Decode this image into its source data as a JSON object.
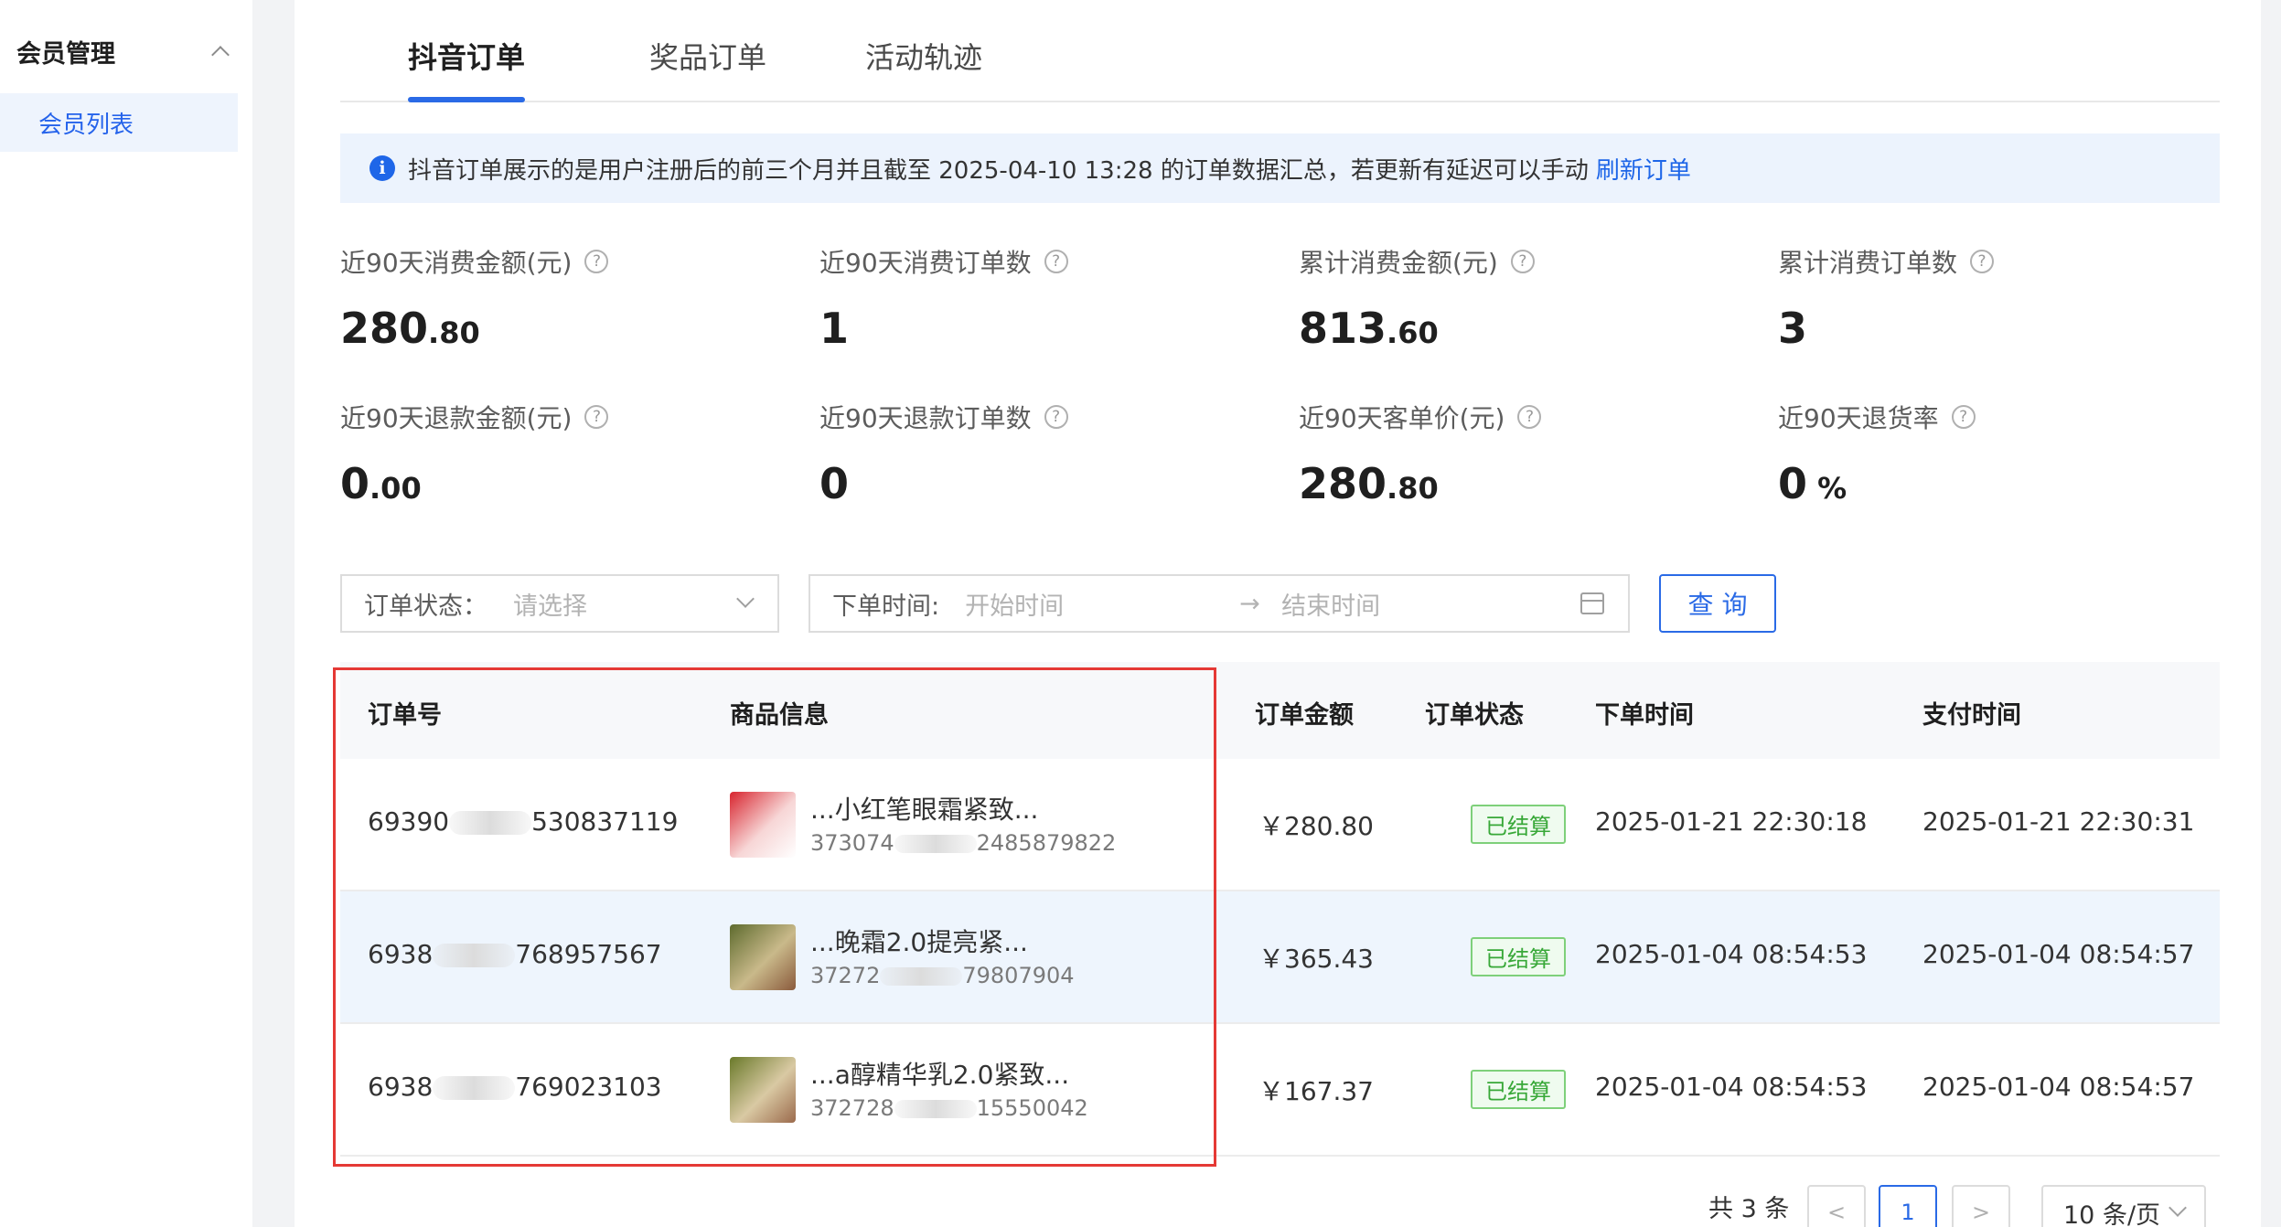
{
  "sidebar": {
    "group_title": "会员管理",
    "items": [
      {
        "label": "会员列表"
      }
    ]
  },
  "tabs": [
    {
      "label": "抖音订单",
      "active": true
    },
    {
      "label": "奖品订单",
      "active": false
    },
    {
      "label": "活动轨迹",
      "active": false
    }
  ],
  "notice": {
    "text": "抖音订单展示的是用户注册后的前三个月并且截至 2025-04-10 13:28 的订单数据汇总，若更新有延迟可以手动",
    "link": "刷新订单"
  },
  "stats": [
    {
      "label": "近90天消费金额(元)",
      "int": "280",
      "dec": ".80"
    },
    {
      "label": "近90天消费订单数",
      "int": "1",
      "dec": ""
    },
    {
      "label": "累计消费金额(元)",
      "int": "813",
      "dec": ".60"
    },
    {
      "label": "累计消费订单数",
      "int": "3",
      "dec": ""
    },
    {
      "label": "近90天退款金额(元)",
      "int": "0",
      "dec": ".00"
    },
    {
      "label": "近90天退款订单数",
      "int": "0",
      "dec": ""
    },
    {
      "label": "近90天客单价(元)",
      "int": "280",
      "dec": ".80"
    },
    {
      "label": "近90天退货率",
      "int": "0",
      "dec": " %"
    }
  ],
  "filters": {
    "status_label": "订单状态：",
    "status_placeholder": "请选择",
    "time_label": "下单时间:",
    "start_placeholder": "开始时间",
    "arrow": "→",
    "end_placeholder": "结束时间",
    "query_button": "查 询"
  },
  "table": {
    "headers": [
      "订单号",
      "商品信息",
      "订单金额",
      "订单状态",
      "下单时间",
      "支付时间"
    ],
    "rows": [
      {
        "order_pre": "69390",
        "order_post": "530837119",
        "product_name": "...小红笔眼霜紧致...",
        "pid_pre": "373074",
        "pid_post": "2485879822",
        "amount": "￥280.80",
        "status": "已结算",
        "order_time": "2025-01-21 22:30:18",
        "pay_time": "2025-01-21 22:30:31"
      },
      {
        "order_pre": "6938",
        "order_post": "768957567",
        "product_name": "...晚霜2.0提亮紧...",
        "pid_pre": "37272",
        "pid_post": "79807904",
        "amount": "￥365.43",
        "status": "已结算",
        "order_time": "2025-01-04 08:54:53",
        "pay_time": "2025-01-04 08:54:57"
      },
      {
        "order_pre": "6938",
        "order_post": "769023103",
        "product_name": "...a醇精华乳2.0紧致...",
        "pid_pre": "372728",
        "pid_post": "15550042",
        "amount": "￥167.37",
        "status": "已结算",
        "order_time": "2025-01-04 08:54:53",
        "pay_time": "2025-01-04 08:54:57"
      }
    ]
  },
  "pagination": {
    "total": "共 3 条",
    "prev": "<",
    "current": "1",
    "next": ">",
    "page_size": "10 条/页"
  }
}
